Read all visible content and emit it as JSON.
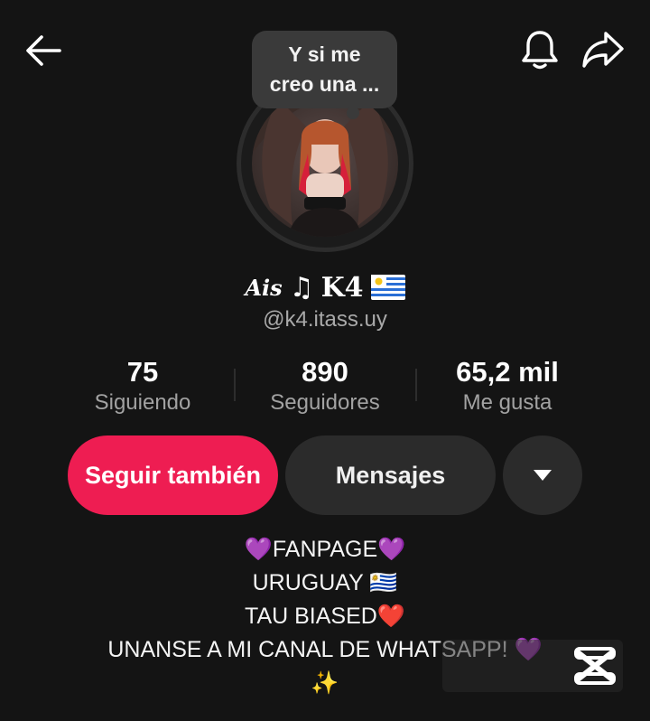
{
  "header": {
    "back_icon": "arrow-left-icon",
    "notification_icon": "bell-icon",
    "share_icon": "share-arrow-icon"
  },
  "note_bubble": {
    "line1": "Y si me",
    "line2": "creo una ..."
  },
  "profile": {
    "name_script": "Ais",
    "name_note": "♫",
    "name_main": "K4",
    "name_flag": "🇺🇾",
    "handle": "@k4.itass.uy"
  },
  "stats": [
    {
      "value": "75",
      "label": "Siguiendo"
    },
    {
      "value": "890",
      "label": "Seguidores"
    },
    {
      "value": "65,2 mil",
      "label": "Me gusta"
    }
  ],
  "actions": {
    "follow_label": "Seguir también",
    "message_label": "Mensajes",
    "more_icon": "caret-down-icon"
  },
  "bio": [
    "💜FANPAGE💜",
    "URUGUAY 🇺🇾",
    "TAU BIASED❤️",
    "UNANSE A MI CANAL DE WHATSAPP! 💜",
    "✨"
  ],
  "colors": {
    "background": "#141414",
    "follow_button": "#ee1d52",
    "secondary_button": "#2b2b2b",
    "muted_text": "#a2a2a2"
  }
}
